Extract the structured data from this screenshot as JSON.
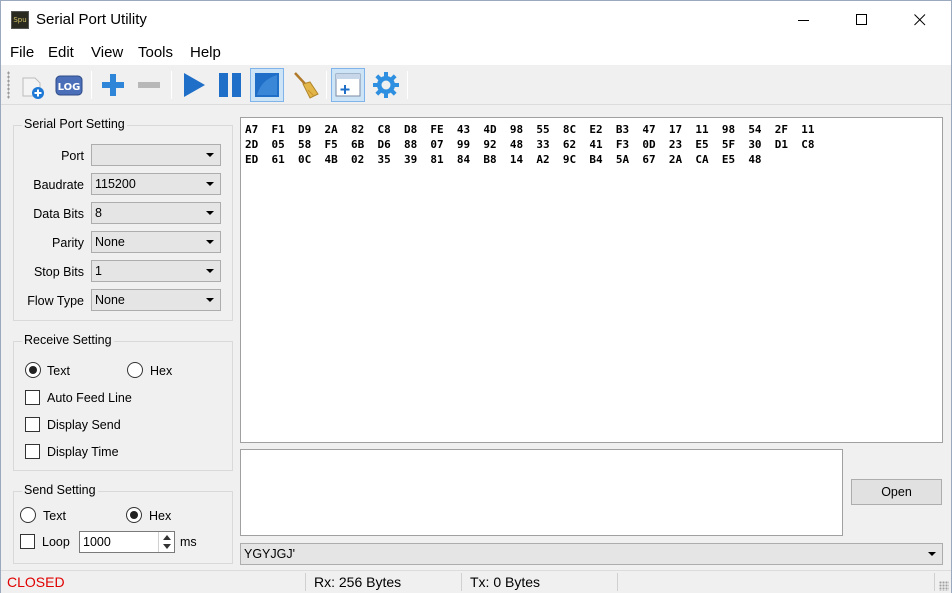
{
  "window": {
    "title": "Serial Port Utility",
    "app_icon_text": "Spu"
  },
  "menu": [
    "File",
    "Edit",
    "View",
    "Tools",
    "Help"
  ],
  "toolbar": {
    "log_label": "LOG",
    "buttons": [
      "new-session",
      "log",
      "add",
      "remove",
      "run",
      "pause",
      "stop",
      "clear",
      "window",
      "settings"
    ]
  },
  "serial": {
    "title": "Serial Port Setting",
    "fields": [
      {
        "label": "Port",
        "value": ""
      },
      {
        "label": "Baudrate",
        "value": "115200"
      },
      {
        "label": "Data Bits",
        "value": "8"
      },
      {
        "label": "Parity",
        "value": "None"
      },
      {
        "label": "Stop Bits",
        "value": "1"
      },
      {
        "label": "Flow Type",
        "value": "None"
      }
    ]
  },
  "receive": {
    "title": "Receive Setting",
    "text_label": "Text",
    "hex_label": "Hex",
    "mode": "Text",
    "auto_feed": "Auto Feed Line",
    "display_send": "Display Send",
    "display_time": "Display Time"
  },
  "send_setting": {
    "title": "Send Setting",
    "text_label": "Text",
    "hex_label": "Hex",
    "mode": "Hex",
    "loop_label": "Loop",
    "interval": "1000",
    "unit": "ms"
  },
  "receive_data": [
    "A7  F1  D9  2A  82  C8  D8  FE  43  4D  98  55  8C  E2  B3  47  17  11  98  54  2F  11",
    "2D  05  58  F5  6B  D6  88  07  99  92  48  33  62  41  F3  0D  23  E5  5F  30  D1  C8",
    "ED  61  0C  4B  02  35  39  81  84  B8  14  A2  9C  B4  5A  67  2A  CA  E5  48"
  ],
  "send_area": {
    "open_label": "Open",
    "history_value": "YGYJGJ'"
  },
  "status": {
    "state": "CLOSED",
    "state_color": "#e00000",
    "rx": "Rx: 256 Bytes",
    "tx": "Tx: 0 Bytes"
  }
}
